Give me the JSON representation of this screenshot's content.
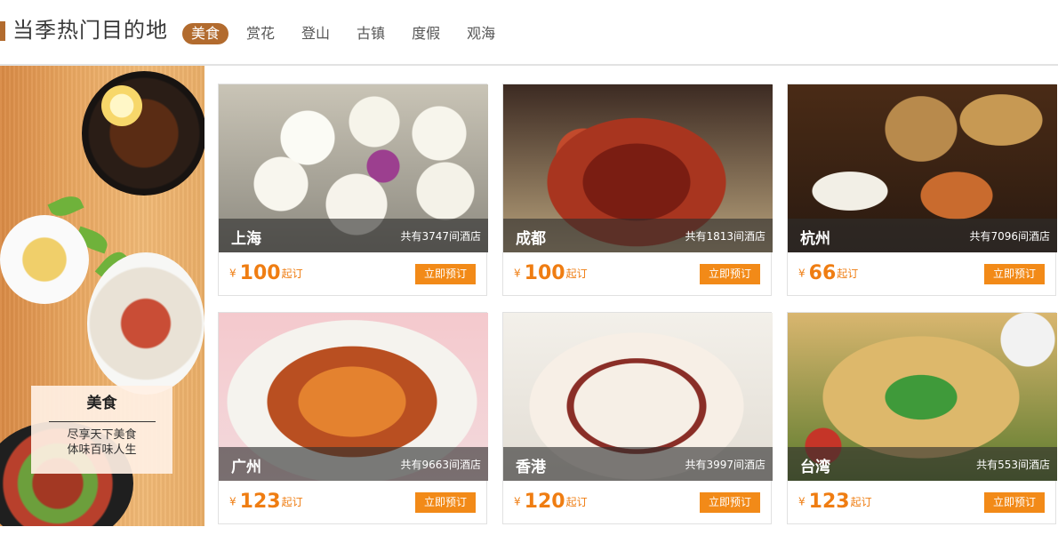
{
  "header": {
    "title": "当季热门目的地",
    "tabs": [
      {
        "label": "美食",
        "active": true
      },
      {
        "label": "赏花",
        "active": false
      },
      {
        "label": "登山",
        "active": false
      },
      {
        "label": "古镇",
        "active": false
      },
      {
        "label": "度假",
        "active": false
      },
      {
        "label": "观海",
        "active": false
      }
    ],
    "accent_color": "#b26b2e"
  },
  "promo": {
    "title": "美食",
    "line1": "尽享天下美食",
    "line2": "体味百味人生"
  },
  "cards": [
    {
      "city": "上海",
      "hotels": "共有3747间酒店",
      "currency": "¥",
      "price": "100",
      "suffix": "起订",
      "button": "立即预订"
    },
    {
      "city": "成都",
      "hotels": "共有1813间酒店",
      "currency": "¥",
      "price": "100",
      "suffix": "起订",
      "button": "立即预订"
    },
    {
      "city": "杭州",
      "hotels": "共有7096间酒店",
      "currency": "¥",
      "price": "66",
      "suffix": "起订",
      "button": "立即预订"
    },
    {
      "city": "广州",
      "hotels": "共有9663间酒店",
      "currency": "¥",
      "price": "123",
      "suffix": "起订",
      "button": "立即预订"
    },
    {
      "city": "香港",
      "hotels": "共有3997间酒店",
      "currency": "¥",
      "price": "120",
      "suffix": "起订",
      "button": "立即预订"
    },
    {
      "city": "台湾",
      "hotels": "共有553间酒店",
      "currency": "¥",
      "price": "123",
      "suffix": "起订",
      "button": "立即预订"
    }
  ],
  "colors": {
    "price": "#ef7d12",
    "button": "#f28a18"
  }
}
